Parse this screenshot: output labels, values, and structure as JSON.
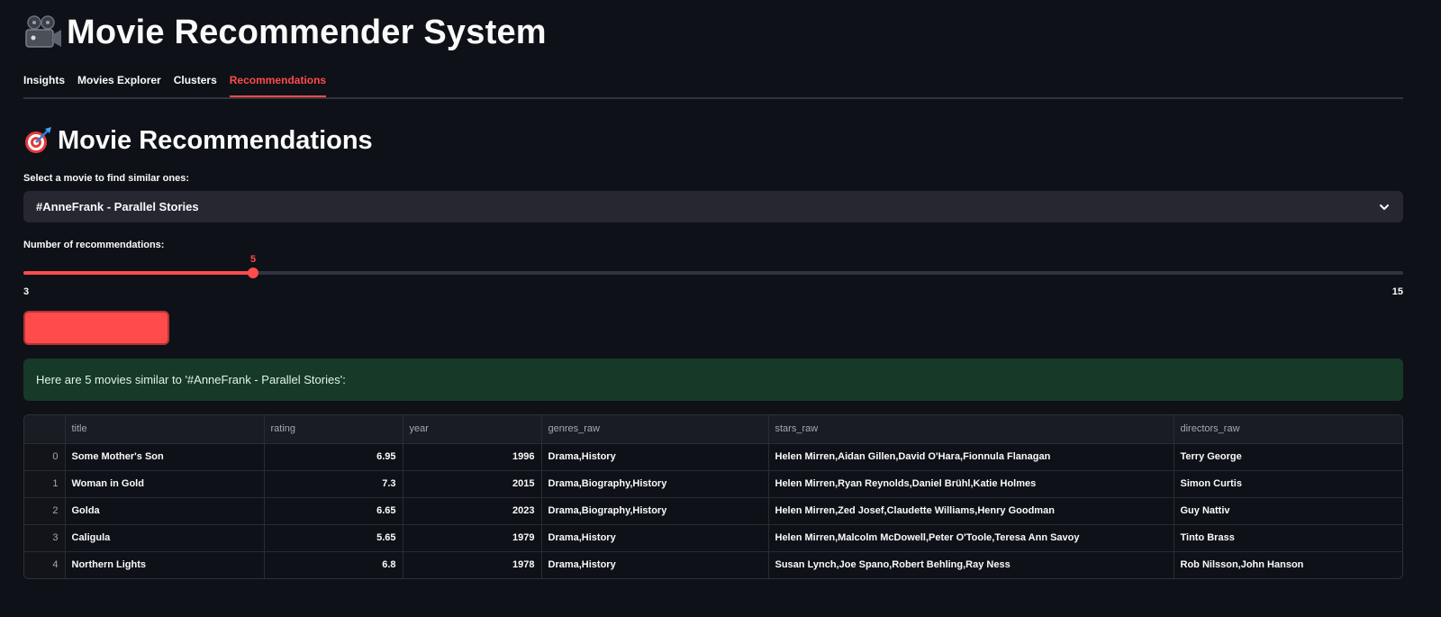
{
  "app": {
    "title": "Movie Recommender System",
    "title_icon": "film-camera-icon"
  },
  "tabs": [
    {
      "label": "Insights",
      "active": false
    },
    {
      "label": "Movies Explorer",
      "active": false
    },
    {
      "label": "Clusters",
      "active": false
    },
    {
      "label": "Recommendations",
      "active": true
    }
  ],
  "section": {
    "title": "Movie Recommendations",
    "title_icon": "dart-target-icon"
  },
  "movie_select": {
    "label": "Select a movie to find similar ones:",
    "value": "#AnneFrank - Parallel Stories"
  },
  "slider": {
    "label": "Number of recommendations:",
    "value": "5",
    "min": "3",
    "max": "15",
    "fraction": 0.1667
  },
  "button": {
    "label": ""
  },
  "result": {
    "message": "Here are 5 movies similar to '#AnneFrank - Parallel Stories':"
  },
  "table": {
    "columns": [
      "",
      "title",
      "rating",
      "year",
      "genres_raw",
      "stars_raw",
      "directors_raw"
    ],
    "rows": [
      [
        "0",
        "Some Mother's Son",
        "6.95",
        "1996",
        "Drama,History",
        "Helen Mirren,Aidan Gillen,David O'Hara,Fionnula Flanagan",
        "Terry George"
      ],
      [
        "1",
        "Woman in Gold",
        "7.3",
        "2015",
        "Drama,Biography,History",
        "Helen Mirren,Ryan Reynolds,Daniel Brühl,Katie Holmes",
        "Simon Curtis"
      ],
      [
        "2",
        "Golda",
        "6.65",
        "2023",
        "Drama,Biography,History",
        "Helen Mirren,Zed Josef,Claudette Williams,Henry Goodman",
        "Guy Nattiv"
      ],
      [
        "3",
        "Caligula",
        "5.65",
        "1979",
        "Drama,History",
        "Helen Mirren,Malcolm McDowell,Peter O'Toole,Teresa Ann Savoy",
        "Tinto Brass"
      ],
      [
        "4",
        "Northern Lights",
        "6.8",
        "1978",
        "Drama,History",
        "Susan Lynch,Joe Spano,Robert Behling,Ray Ness",
        "Rob Nilsson,John Hanson"
      ]
    ]
  },
  "colors": {
    "background": "#0e1117",
    "accent": "#ff4b4b",
    "success_bg": "#173928"
  }
}
